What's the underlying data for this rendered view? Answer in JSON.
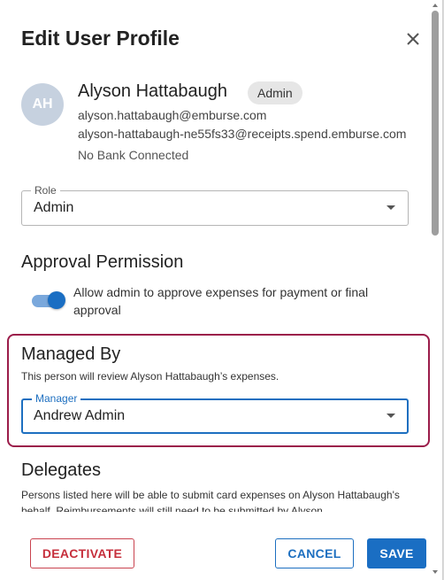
{
  "dialog": {
    "title": "Edit User Profile",
    "close_icon": "close-icon"
  },
  "user": {
    "initials": "AH",
    "name": "Alyson Hattabaugh",
    "role_badge": "Admin",
    "email": "alyson.hattabaugh@emburse.com",
    "receipts_email": "alyson-hattabaugh-ne55fs33@receipts.spend.emburse.com",
    "bank_status": "No Bank Connected"
  },
  "role_field": {
    "label": "Role",
    "value": "Admin"
  },
  "approval": {
    "title": "Approval Permission",
    "toggle_on": true,
    "toggle_label": "Allow admin to approve expenses for payment or final approval"
  },
  "managed_by": {
    "title": "Managed By",
    "description": "This person will review Alyson Hattabaugh’s expenses.",
    "manager_label": "Manager",
    "manager_value": "Andrew Admin"
  },
  "delegates": {
    "title": "Delegates",
    "description": "Persons listed here will be able to submit card expenses on Alyson Hattabaugh's behalf. Reimbursements will still need to be submitted by Alyson."
  },
  "footer": {
    "deactivate_label": "DEACTIVATE",
    "cancel_label": "CANCEL",
    "save_label": "SAVE"
  },
  "colors": {
    "primary": "#1a6ec3",
    "danger": "#c62f3c",
    "highlight": "#9b1c4a",
    "avatar_bg": "#c6d1df"
  }
}
